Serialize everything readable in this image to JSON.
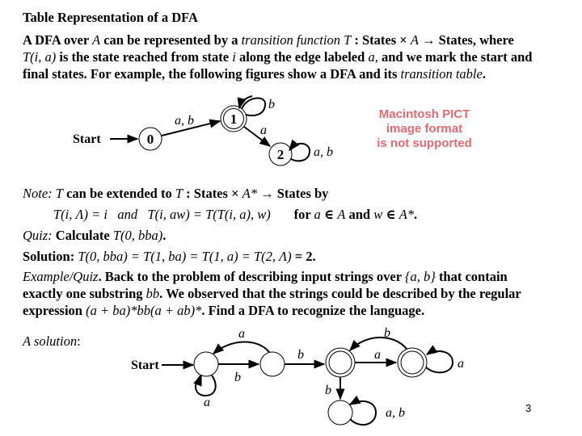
{
  "title": "Table Representation of a DFA",
  "intro": {
    "l1": [
      "A DFA over ",
      "A",
      " can be represented by a ",
      "transition function T",
      " : States × ",
      "A",
      " → States, where"
    ],
    "l2": [
      "T(i, a)",
      " is the state reached from state ",
      "i",
      " along the edge labeled ",
      "a,",
      " and we mark the start and"
    ],
    "l3": [
      "final states. For example, the following figures show a DFA and its ",
      "transition table",
      "."
    ]
  },
  "dfa1": {
    "start_label": "Start",
    "nodes": [
      {
        "id": "0",
        "label": "0",
        "accepting": false
      },
      {
        "id": "1",
        "label": "1",
        "accepting": true
      },
      {
        "id": "2",
        "label": "2",
        "accepting": false
      }
    ],
    "edges": [
      {
        "from": "start",
        "to": "0",
        "label": ""
      },
      {
        "from": "0",
        "to": "1",
        "label": "a, b"
      },
      {
        "from": "1",
        "to": "1",
        "label": "b"
      },
      {
        "from": "1",
        "to": "2",
        "label": "a"
      },
      {
        "from": "2",
        "to": "2",
        "label": "a, b"
      }
    ]
  },
  "pict_placeholder": {
    "line1": "Macintosh PICT",
    "line2": "image format",
    "line3": "is not supported",
    "color": "#e06a72"
  },
  "note": {
    "l1": [
      "Note:",
      " T",
      " can be extended to ",
      "T",
      " : States × ",
      "A*",
      " → States by"
    ],
    "l2": [
      "T(i, Λ) = i",
      "   and   ",
      "T(i, aw) = T(T(i, a), w)",
      "       for ",
      "a",
      " ∈ ",
      "A",
      " and ",
      "w",
      " ∈ ",
      "A*",
      "."
    ]
  },
  "quiz": [
    "Quiz:",
    " Calculate ",
    "T(0, bba)",
    "."
  ],
  "solution": [
    "Solution: ",
    "T(0, bba) = T(1, ba) = T(1, a) = T(2, Λ)",
    " = 2."
  ],
  "example": {
    "l1": [
      "Example/Quiz",
      ". Back to the problem of describing input strings over ",
      "{a, b}",
      " that contain"
    ],
    "l2": [
      "exactly one substring ",
      "bb",
      ". We observed that the strings could be described by the regular"
    ],
    "l3": [
      "expression ",
      "(a + ba)*bb(a + ab)*",
      ". Find a DFA to recognize the language."
    ]
  },
  "solution_label": [
    "A solution",
    ":"
  ],
  "dfa2": {
    "start_label": "Start",
    "nodes": [
      {
        "id": "s0",
        "accepting": false
      },
      {
        "id": "s1",
        "accepting": false
      },
      {
        "id": "s2",
        "accepting": true
      },
      {
        "id": "s3",
        "accepting": true
      },
      {
        "id": "s4",
        "accepting": false
      }
    ],
    "edges": [
      {
        "from": "start",
        "to": "s0",
        "label": ""
      },
      {
        "from": "s0",
        "to": "s0",
        "label": "a"
      },
      {
        "from": "s0",
        "to": "s1",
        "label": "b"
      },
      {
        "from": "s1",
        "to": "s0",
        "label": "a"
      },
      {
        "from": "s1",
        "to": "s2",
        "label": "b"
      },
      {
        "from": "s2",
        "to": "s3",
        "label": "a"
      },
      {
        "from": "s3",
        "to": "s2",
        "label": "b"
      },
      {
        "from": "s3",
        "to": "s3",
        "label": "a"
      },
      {
        "from": "s2",
        "to": "s4",
        "label": "b"
      },
      {
        "from": "s4",
        "to": "s4",
        "label": "a, b"
      }
    ]
  },
  "page_number": "3"
}
